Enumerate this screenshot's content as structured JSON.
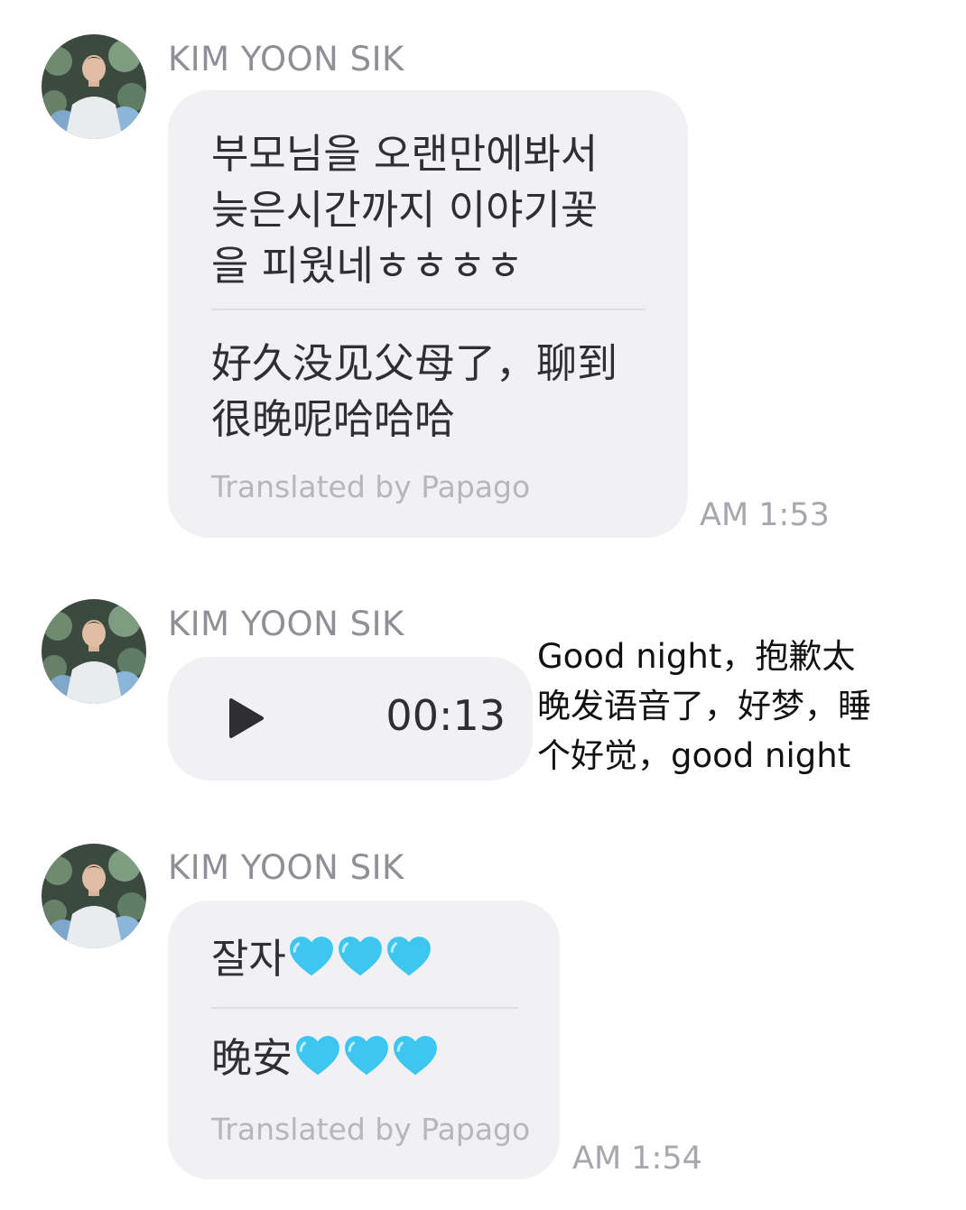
{
  "messages": [
    {
      "sender": "KIM YOON SIK",
      "original": "부모님을 오랜만에봐서\n늦은시간까지 이야기꽃\n을 피웠네ㅎㅎㅎㅎ",
      "translation": "好久没见父母了，聊到\n很晚呢哈哈哈",
      "translation_credit": "Translated by Papago",
      "time": "AM 1:53"
    },
    {
      "sender": "KIM YOON SIK",
      "type": "voice",
      "play_icon": "play-icon",
      "duration": "00:13"
    },
    {
      "sender": "KIM YOON SIK",
      "original": "잘자",
      "translation": "晚安",
      "hearts": 3,
      "heart_icon": "blue-heart-icon",
      "heart_color": "#3cc6f0",
      "translation_credit": "Translated by Papago",
      "time": "AM 1:54"
    }
  ],
  "annotation": "Good night，抱歉太\n晚发语音了，好梦，睡\n个好觉，good night",
  "colors": {
    "bubble": "#f1f1f4",
    "sender": "#8f8f96",
    "text": "#2e2e33",
    "timestamp": "#a7a7ad",
    "credit": "#b6b6bc"
  }
}
